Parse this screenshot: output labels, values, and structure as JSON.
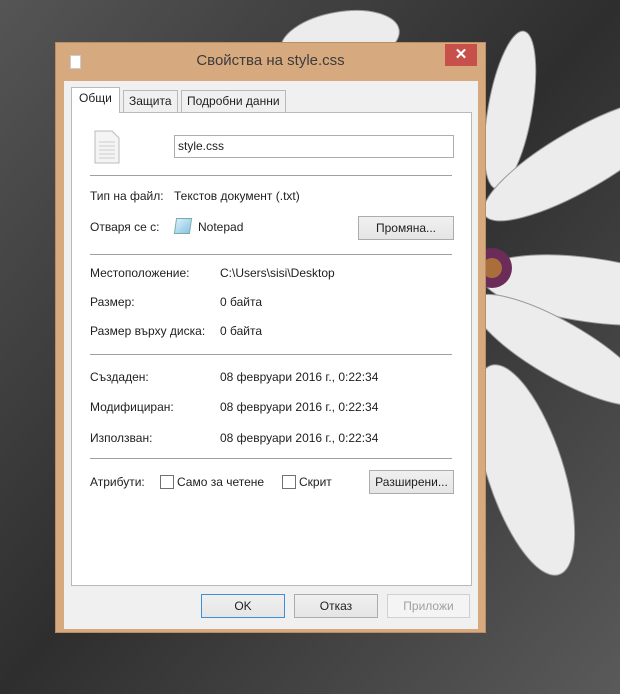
{
  "window": {
    "title": "Свойства на style.css",
    "close_label": "✕"
  },
  "tabs": [
    {
      "label": "Общи",
      "active": true
    },
    {
      "label": "Защита"
    },
    {
      "label": "Подробни данни"
    }
  ],
  "general": {
    "file_name": "style.css",
    "type_label": "Тип на файл:",
    "type_value": "Текстов документ (.txt)",
    "opens_label": "Отваря се с:",
    "opens_value": "Notepad",
    "change_button": "Промяна...",
    "location_label": "Местоположение:",
    "location_value": "C:\\Users\\sisi\\Desktop",
    "size_label": "Размер:",
    "size_value": "0 байта",
    "disk_size_label": "Размер върху диска:",
    "disk_size_value": "0 байта",
    "created_label": "Създаден:",
    "created_value": "08 февруари 2016 г., 0:22:34",
    "modified_label": "Модифициран:",
    "modified_value": "08 февруари 2016 г., 0:22:34",
    "accessed_label": "Използван:",
    "accessed_value": "08 февруари 2016 г., 0:22:34",
    "attributes_label": "Атрибути:",
    "readonly_label": "Само за четене",
    "readonly_checked": false,
    "hidden_label": "Скрит",
    "hidden_checked": false,
    "advanced_button": "Разширени..."
  },
  "buttons": {
    "ok": "OK",
    "cancel": "Отказ",
    "apply": "Приложи"
  },
  "colors": {
    "frame": "#d7a97f",
    "close": "#c7504a",
    "ok_border": "#3c8fd8"
  }
}
